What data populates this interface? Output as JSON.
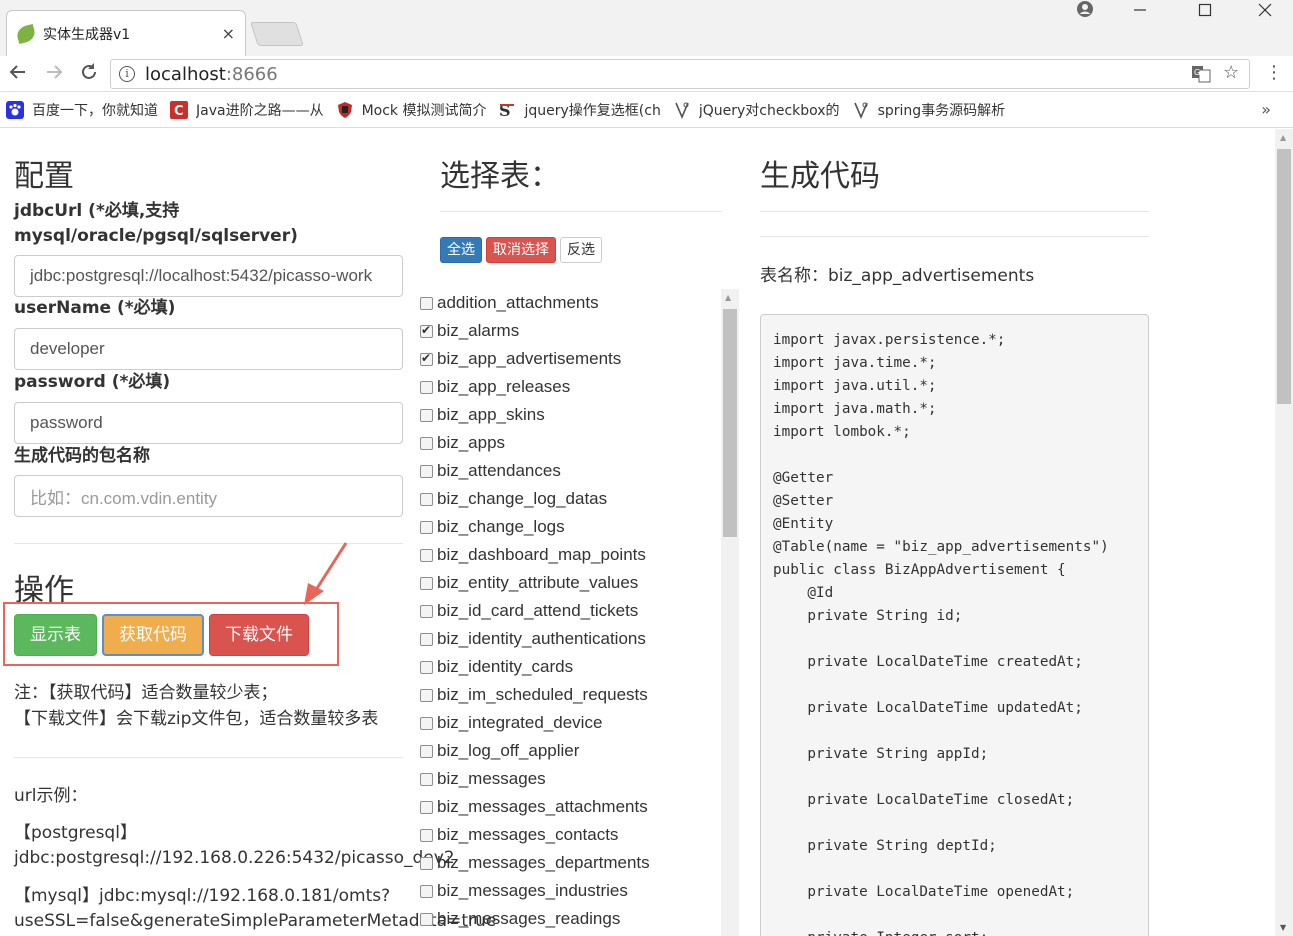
{
  "browser": {
    "tab_title": "实体生成器v1",
    "tab_close": "×",
    "url_host": "localhost",
    "url_port": ":8666",
    "bookmarks": [
      {
        "label": "百度一下，你就知道",
        "icon": "baidu-paw-icon",
        "color": "#2932e1"
      },
      {
        "label": "Java进阶之路——从",
        "icon": "csdn-c-icon",
        "color": "#c9302c"
      },
      {
        "label": "Mock 模拟测试简介",
        "icon": "shield-icon",
        "color": "#c62828"
      },
      {
        "label": "jquery操作复选框(ch",
        "icon": "script-s-icon",
        "color": "#333333"
      },
      {
        "label": "jQuery对checkbox的",
        "icon": "page-icon",
        "color": "#555555"
      },
      {
        "label": "spring事务源码解析",
        "icon": "page-icon",
        "color": "#555555"
      }
    ],
    "bookmarks_overflow": "»"
  },
  "config": {
    "heading": "配置",
    "jdbc_label": "jdbcUrl (*必填,支持 mysql/oracle/pgsql/sqlserver)",
    "jdbc_value": "jdbc:postgresql://localhost:5432/picasso-work",
    "username_label": "userName (*必填)",
    "username_value": "developer",
    "password_label": "password (*必填)",
    "password_value": "password",
    "package_label": "生成代码的包名称",
    "package_placeholder": "比如：cn.com.vdin.entity"
  },
  "ops": {
    "heading": "操作",
    "show_tables": "显示表",
    "get_code": "获取代码",
    "download": "下载文件",
    "note1": "注：【获取代码】适合数量较少表；",
    "note2": "【下载文件】会下载zip文件包，适合数量较多表",
    "url_example_label": "url示例：",
    "pg_example_1": "【postgresql】",
    "pg_example_2": "jdbc:postgresql://192.168.0.226:5432/picasso_dev2",
    "mysql_example_1": "【mysql】jdbc:mysql://192.168.0.181/omts?",
    "mysql_example_2": "useSSL=false&generateSimpleParameterMetadata=true"
  },
  "tables": {
    "heading": "选择表：",
    "select_all": "全选",
    "cancel_select": "取消选择",
    "invert": "反选",
    "items": [
      {
        "name": "addition_attachments",
        "checked": false
      },
      {
        "name": "biz_alarms",
        "checked": true
      },
      {
        "name": "biz_app_advertisements",
        "checked": true
      },
      {
        "name": "biz_app_releases",
        "checked": false
      },
      {
        "name": "biz_app_skins",
        "checked": false
      },
      {
        "name": "biz_apps",
        "checked": false
      },
      {
        "name": "biz_attendances",
        "checked": false
      },
      {
        "name": "biz_change_log_datas",
        "checked": false
      },
      {
        "name": "biz_change_logs",
        "checked": false
      },
      {
        "name": "biz_dashboard_map_points",
        "checked": false
      },
      {
        "name": "biz_entity_attribute_values",
        "checked": false
      },
      {
        "name": "biz_id_card_attend_tickets",
        "checked": false
      },
      {
        "name": "biz_identity_authentications",
        "checked": false
      },
      {
        "name": "biz_identity_cards",
        "checked": false
      },
      {
        "name": "biz_im_scheduled_requests",
        "checked": false
      },
      {
        "name": "biz_integrated_device",
        "checked": false
      },
      {
        "name": "biz_log_off_applier",
        "checked": false
      },
      {
        "name": "biz_messages",
        "checked": false
      },
      {
        "name": "biz_messages_attachments",
        "checked": false
      },
      {
        "name": "biz_messages_contacts",
        "checked": false
      },
      {
        "name": "biz_messages_departments",
        "checked": false
      },
      {
        "name": "biz_messages_industries",
        "checked": false
      },
      {
        "name": "biz_messages_readings",
        "checked": false
      }
    ]
  },
  "code": {
    "heading": "生成代码",
    "table_name": "表名称：biz_app_advertisements",
    "source": "import javax.persistence.*;\nimport java.time.*;\nimport java.util.*;\nimport java.math.*;\nimport lombok.*;\n\n@Getter\n@Setter\n@Entity\n@Table(name = \"biz_app_advertisements\")\npublic class BizAppAdvertisement {\n    @Id\n    private String id;\n\n    private LocalDateTime createdAt;\n\n    private LocalDateTime updatedAt;\n\n    private String appId;\n\n    private LocalDateTime closedAt;\n\n    private String deptId;\n\n    private LocalDateTime openedAt;\n\n    private Integer sort;"
  },
  "colors": {
    "green": "#5cb85c",
    "orange": "#f0ad4e",
    "red": "#d9534f",
    "blue": "#337ab7",
    "annotation": "#e8655a"
  }
}
